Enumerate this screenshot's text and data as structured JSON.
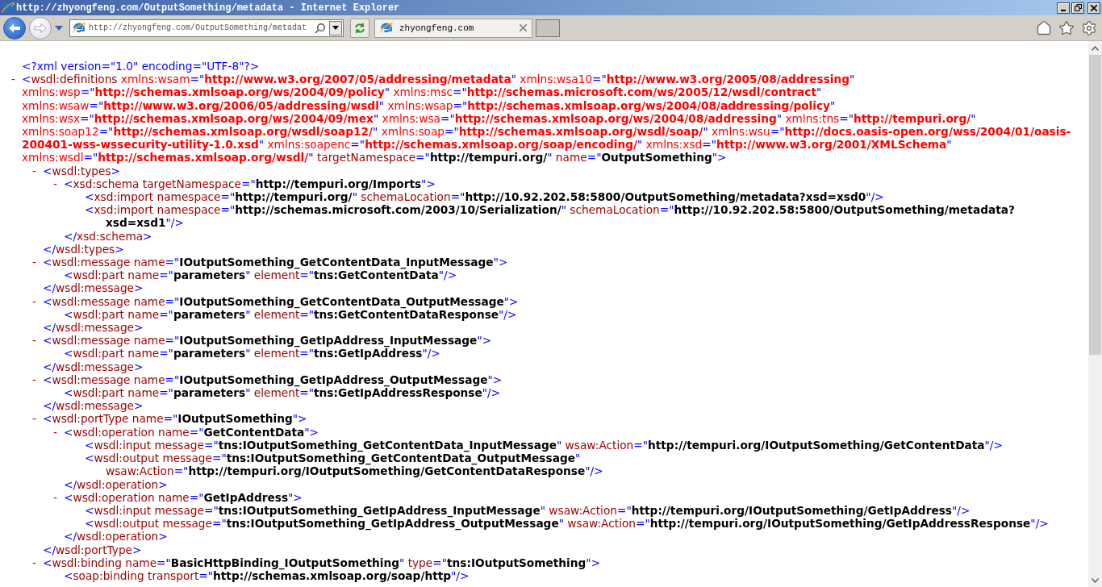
{
  "window": {
    "title": "http://zhyongfeng.com/OutputSomething/metadata - Internet Explorer"
  },
  "address_bar": {
    "value": "http://zhyongfeng.com/OutputSomething/metadat"
  },
  "tabs": [
    {
      "label": "zhyongfeng.com",
      "selected": true
    }
  ],
  "document": {
    "prolog": [
      {
        "kind": "pi",
        "text": "<?xml version=\"1.0\" encoding=\"UTF-8\"?>"
      }
    ],
    "root": {
      "toggle": "-",
      "open": [
        {
          "kind": "punct",
          "text": "<"
        },
        {
          "kind": "tag",
          "text": "wsdl:definitions"
        },
        {
          "kind": "ns_attr",
          "text": " xmlns:wsam"
        },
        {
          "kind": "punct",
          "text": "=\""
        },
        {
          "kind": "ns_value",
          "text": "http://www.w3.org/2007/05/addressing/metadata"
        },
        {
          "kind": "punct",
          "text": "\""
        },
        {
          "kind": "ns_attr",
          "text": " xmlns:wsa10"
        },
        {
          "kind": "punct",
          "text": "=\""
        },
        {
          "kind": "ns_value",
          "text": "http://www.w3.org/2005/08/addressing"
        },
        {
          "kind": "punct",
          "text": "\""
        },
        {
          "kind": "ns_attr",
          "text": " xmlns:wsp"
        },
        {
          "kind": "punct",
          "text": "=\""
        },
        {
          "kind": "ns_value",
          "text": "http://schemas.xmlsoap.org/ws/2004/09/policy"
        },
        {
          "kind": "punct",
          "text": "\""
        },
        {
          "kind": "ns_attr",
          "text": " xmlns:msc"
        },
        {
          "kind": "punct",
          "text": "=\""
        },
        {
          "kind": "ns_value",
          "text": "http://schemas.microsoft.com/ws/2005/12/wsdl/contract"
        },
        {
          "kind": "punct",
          "text": "\""
        },
        {
          "kind": "ns_attr",
          "text": " xmlns:wsaw"
        },
        {
          "kind": "punct",
          "text": "=\""
        },
        {
          "kind": "ns_value",
          "text": "http://www.w3.org/2006/05/addressing/wsdl"
        },
        {
          "kind": "punct",
          "text": "\""
        },
        {
          "kind": "ns_attr",
          "text": " xmlns:wsap"
        },
        {
          "kind": "punct",
          "text": "=\""
        },
        {
          "kind": "ns_value",
          "text": "http://schemas.xmlsoap.org/ws/2004/08/addressing/policy"
        },
        {
          "kind": "punct",
          "text": "\""
        },
        {
          "kind": "ns_attr",
          "text": " xmlns:wsx"
        },
        {
          "kind": "punct",
          "text": "=\""
        },
        {
          "kind": "ns_value",
          "text": "http://schemas.xmlsoap.org/ws/2004/09/mex"
        },
        {
          "kind": "punct",
          "text": "\""
        },
        {
          "kind": "ns_attr",
          "text": " xmlns:wsa"
        },
        {
          "kind": "punct",
          "text": "=\""
        },
        {
          "kind": "ns_value",
          "text": "http://schemas.xmlsoap.org/ws/2004/08/addressing"
        },
        {
          "kind": "punct",
          "text": "\""
        },
        {
          "kind": "ns_attr",
          "text": " xmlns:tns"
        },
        {
          "kind": "punct",
          "text": "=\""
        },
        {
          "kind": "ns_value",
          "text": "http://tempuri.org/"
        },
        {
          "kind": "punct",
          "text": "\""
        },
        {
          "kind": "ns_attr",
          "text": " xmlns:soap12"
        },
        {
          "kind": "punct",
          "text": "=\""
        },
        {
          "kind": "ns_value",
          "text": "http://schemas.xmlsoap.org/wsdl/soap12/"
        },
        {
          "kind": "punct",
          "text": "\""
        },
        {
          "kind": "ns_attr",
          "text": " xmlns:soap"
        },
        {
          "kind": "punct",
          "text": "=\""
        },
        {
          "kind": "ns_value",
          "text": "http://schemas.xmlsoap.org/wsdl/soap/"
        },
        {
          "kind": "punct",
          "text": "\""
        },
        {
          "kind": "ns_attr",
          "text": " xmlns:wsu"
        },
        {
          "kind": "punct",
          "text": "=\""
        },
        {
          "kind": "ns_value",
          "text": "http://docs.oasis-open.org/wss/2004/01/oasis-200401-wss-wssecurity-utility-1.0.xsd"
        },
        {
          "kind": "punct",
          "text": "\""
        },
        {
          "kind": "ns_attr",
          "text": " xmlns:soapenc"
        },
        {
          "kind": "punct",
          "text": "=\""
        },
        {
          "kind": "ns_value",
          "text": "http://schemas.xmlsoap.org/soap/encoding/"
        },
        {
          "kind": "punct",
          "text": "\""
        },
        {
          "kind": "ns_attr",
          "text": " xmlns:xsd"
        },
        {
          "kind": "punct",
          "text": "=\""
        },
        {
          "kind": "ns_value",
          "text": "http://www.w3.org/2001/XMLSchema"
        },
        {
          "kind": "punct",
          "text": "\""
        },
        {
          "kind": "ns_attr",
          "text": " xmlns:wsdl"
        },
        {
          "kind": "punct",
          "text": "=\""
        },
        {
          "kind": "ns_value",
          "text": "http://schemas.xmlsoap.org/wsdl/"
        },
        {
          "kind": "punct",
          "text": "\""
        },
        {
          "kind": "attr",
          "text": " targetNamespace"
        },
        {
          "kind": "punct",
          "text": "=\""
        },
        {
          "kind": "value",
          "text": "http://tempuri.org/"
        },
        {
          "kind": "punct",
          "text": "\""
        },
        {
          "kind": "attr",
          "text": " name"
        },
        {
          "kind": "punct",
          "text": "=\""
        },
        {
          "kind": "value",
          "text": "OutputSomething"
        },
        {
          "kind": "punct",
          "text": "\">"
        }
      ],
      "children": [
        {
          "toggle": "-",
          "open": [
            {
              "kind": "punct",
              "text": "<"
            },
            {
              "kind": "tag",
              "text": "wsdl:types"
            },
            {
              "kind": "punct",
              "text": ">"
            }
          ],
          "children": [
            {
              "toggle": "-",
              "open": [
                {
                  "kind": "punct",
                  "text": "<"
                },
                {
                  "kind": "tag",
                  "text": "xsd:schema"
                },
                {
                  "kind": "attr",
                  "text": " targetNamespace"
                },
                {
                  "kind": "punct",
                  "text": "=\""
                },
                {
                  "kind": "value",
                  "text": "http://tempuri.org/Imports"
                },
                {
                  "kind": "punct",
                  "text": "\">"
                }
              ],
              "children": [
                {
                  "open": [
                    {
                      "kind": "punct",
                      "text": "<"
                    },
                    {
                      "kind": "tag",
                      "text": "xsd:import"
                    },
                    {
                      "kind": "attr",
                      "text": " namespace"
                    },
                    {
                      "kind": "punct",
                      "text": "=\""
                    },
                    {
                      "kind": "value",
                      "text": "http://tempuri.org/"
                    },
                    {
                      "kind": "punct",
                      "text": "\""
                    },
                    {
                      "kind": "attr",
                      "text": " schemaLocation"
                    },
                    {
                      "kind": "punct",
                      "text": "=\""
                    },
                    {
                      "kind": "value",
                      "text": "http://10.92.202.58:5800/OutputSomething/metadata?xsd=xsd0"
                    },
                    {
                      "kind": "punct",
                      "text": "\"/>"
                    }
                  ]
                },
                {
                  "open": [
                    {
                      "kind": "punct",
                      "text": "<"
                    },
                    {
                      "kind": "tag",
                      "text": "xsd:import"
                    },
                    {
                      "kind": "attr",
                      "text": " namespace"
                    },
                    {
                      "kind": "punct",
                      "text": "=\""
                    },
                    {
                      "kind": "value",
                      "text": "http://schemas.microsoft.com/2003/10/Serialization/"
                    },
                    {
                      "kind": "punct",
                      "text": "\""
                    },
                    {
                      "kind": "attr",
                      "text": " schemaLocation"
                    },
                    {
                      "kind": "punct",
                      "text": "=\""
                    },
                    {
                      "kind": "value",
                      "text": "http://10.92.202.58:5800/OutputSomething/metadata?xsd=xsd1"
                    },
                    {
                      "kind": "punct",
                      "text": "\"/>"
                    }
                  ]
                }
              ],
              "close": [
                {
                  "kind": "punct",
                  "text": "</"
                },
                {
                  "kind": "tag",
                  "text": "xsd:schema"
                },
                {
                  "kind": "punct",
                  "text": ">"
                }
              ]
            }
          ],
          "close": [
            {
              "kind": "punct",
              "text": "</"
            },
            {
              "kind": "tag",
              "text": "wsdl:types"
            },
            {
              "kind": "punct",
              "text": ">"
            }
          ]
        },
        {
          "toggle": "-",
          "open": [
            {
              "kind": "punct",
              "text": "<"
            },
            {
              "kind": "tag",
              "text": "wsdl:message"
            },
            {
              "kind": "attr",
              "text": " name"
            },
            {
              "kind": "punct",
              "text": "=\""
            },
            {
              "kind": "value",
              "text": "IOutputSomething_GetContentData_InputMessage"
            },
            {
              "kind": "punct",
              "text": "\">"
            }
          ],
          "children": [
            {
              "open": [
                {
                  "kind": "punct",
                  "text": "<"
                },
                {
                  "kind": "tag",
                  "text": "wsdl:part"
                },
                {
                  "kind": "attr",
                  "text": " name"
                },
                {
                  "kind": "punct",
                  "text": "=\""
                },
                {
                  "kind": "value",
                  "text": "parameters"
                },
                {
                  "kind": "punct",
                  "text": "\""
                },
                {
                  "kind": "attr",
                  "text": " element"
                },
                {
                  "kind": "punct",
                  "text": "=\""
                },
                {
                  "kind": "value",
                  "text": "tns:GetContentData"
                },
                {
                  "kind": "punct",
                  "text": "\"/>"
                }
              ]
            }
          ],
          "close": [
            {
              "kind": "punct",
              "text": "</"
            },
            {
              "kind": "tag",
              "text": "wsdl:message"
            },
            {
              "kind": "punct",
              "text": ">"
            }
          ]
        },
        {
          "toggle": "-",
          "open": [
            {
              "kind": "punct",
              "text": "<"
            },
            {
              "kind": "tag",
              "text": "wsdl:message"
            },
            {
              "kind": "attr",
              "text": " name"
            },
            {
              "kind": "punct",
              "text": "=\""
            },
            {
              "kind": "value",
              "text": "IOutputSomething_GetContentData_OutputMessage"
            },
            {
              "kind": "punct",
              "text": "\">"
            }
          ],
          "children": [
            {
              "open": [
                {
                  "kind": "punct",
                  "text": "<"
                },
                {
                  "kind": "tag",
                  "text": "wsdl:part"
                },
                {
                  "kind": "attr",
                  "text": " name"
                },
                {
                  "kind": "punct",
                  "text": "=\""
                },
                {
                  "kind": "value",
                  "text": "parameters"
                },
                {
                  "kind": "punct",
                  "text": "\""
                },
                {
                  "kind": "attr",
                  "text": " element"
                },
                {
                  "kind": "punct",
                  "text": "=\""
                },
                {
                  "kind": "value",
                  "text": "tns:GetContentDataResponse"
                },
                {
                  "kind": "punct",
                  "text": "\"/>"
                }
              ]
            }
          ],
          "close": [
            {
              "kind": "punct",
              "text": "</"
            },
            {
              "kind": "tag",
              "text": "wsdl:message"
            },
            {
              "kind": "punct",
              "text": ">"
            }
          ]
        },
        {
          "toggle": "-",
          "open": [
            {
              "kind": "punct",
              "text": "<"
            },
            {
              "kind": "tag",
              "text": "wsdl:message"
            },
            {
              "kind": "attr",
              "text": " name"
            },
            {
              "kind": "punct",
              "text": "=\""
            },
            {
              "kind": "value",
              "text": "IOutputSomething_GetIpAddress_InputMessage"
            },
            {
              "kind": "punct",
              "text": "\">"
            }
          ],
          "children": [
            {
              "open": [
                {
                  "kind": "punct",
                  "text": "<"
                },
                {
                  "kind": "tag",
                  "text": "wsdl:part"
                },
                {
                  "kind": "attr",
                  "text": " name"
                },
                {
                  "kind": "punct",
                  "text": "=\""
                },
                {
                  "kind": "value",
                  "text": "parameters"
                },
                {
                  "kind": "punct",
                  "text": "\""
                },
                {
                  "kind": "attr",
                  "text": " element"
                },
                {
                  "kind": "punct",
                  "text": "=\""
                },
                {
                  "kind": "value",
                  "text": "tns:GetIpAddress"
                },
                {
                  "kind": "punct",
                  "text": "\"/>"
                }
              ]
            }
          ],
          "close": [
            {
              "kind": "punct",
              "text": "</"
            },
            {
              "kind": "tag",
              "text": "wsdl:message"
            },
            {
              "kind": "punct",
              "text": ">"
            }
          ]
        },
        {
          "toggle": "-",
          "open": [
            {
              "kind": "punct",
              "text": "<"
            },
            {
              "kind": "tag",
              "text": "wsdl:message"
            },
            {
              "kind": "attr",
              "text": " name"
            },
            {
              "kind": "punct",
              "text": "=\""
            },
            {
              "kind": "value",
              "text": "IOutputSomething_GetIpAddress_OutputMessage"
            },
            {
              "kind": "punct",
              "text": "\">"
            }
          ],
          "children": [
            {
              "open": [
                {
                  "kind": "punct",
                  "text": "<"
                },
                {
                  "kind": "tag",
                  "text": "wsdl:part"
                },
                {
                  "kind": "attr",
                  "text": " name"
                },
                {
                  "kind": "punct",
                  "text": "=\""
                },
                {
                  "kind": "value",
                  "text": "parameters"
                },
                {
                  "kind": "punct",
                  "text": "\""
                },
                {
                  "kind": "attr",
                  "text": " element"
                },
                {
                  "kind": "punct",
                  "text": "=\""
                },
                {
                  "kind": "value",
                  "text": "tns:GetIpAddressResponse"
                },
                {
                  "kind": "punct",
                  "text": "\"/>"
                }
              ]
            }
          ],
          "close": [
            {
              "kind": "punct",
              "text": "</"
            },
            {
              "kind": "tag",
              "text": "wsdl:message"
            },
            {
              "kind": "punct",
              "text": ">"
            }
          ]
        },
        {
          "toggle": "-",
          "open": [
            {
              "kind": "punct",
              "text": "<"
            },
            {
              "kind": "tag",
              "text": "wsdl:portType"
            },
            {
              "kind": "attr",
              "text": " name"
            },
            {
              "kind": "punct",
              "text": "=\""
            },
            {
              "kind": "value",
              "text": "IOutputSomething"
            },
            {
              "kind": "punct",
              "text": "\">"
            }
          ],
          "children": [
            {
              "toggle": "-",
              "open": [
                {
                  "kind": "punct",
                  "text": "<"
                },
                {
                  "kind": "tag",
                  "text": "wsdl:operation"
                },
                {
                  "kind": "attr",
                  "text": " name"
                },
                {
                  "kind": "punct",
                  "text": "=\""
                },
                {
                  "kind": "value",
                  "text": "GetContentData"
                },
                {
                  "kind": "punct",
                  "text": "\">"
                }
              ],
              "children": [
                {
                  "open": [
                    {
                      "kind": "punct",
                      "text": "<"
                    },
                    {
                      "kind": "tag",
                      "text": "wsdl:input"
                    },
                    {
                      "kind": "attr",
                      "text": " message"
                    },
                    {
                      "kind": "punct",
                      "text": "=\""
                    },
                    {
                      "kind": "value",
                      "text": "tns:IOutputSomething_GetContentData_InputMessage"
                    },
                    {
                      "kind": "punct",
                      "text": "\""
                    },
                    {
                      "kind": "attr",
                      "text": " wsaw:Action"
                    },
                    {
                      "kind": "punct",
                      "text": "=\""
                    },
                    {
                      "kind": "value",
                      "text": "http://tempuri.org/IOutputSomething/GetContentData"
                    },
                    {
                      "kind": "punct",
                      "text": "\"/>"
                    }
                  ]
                },
                {
                  "open": [
                    {
                      "kind": "punct",
                      "text": "<"
                    },
                    {
                      "kind": "tag",
                      "text": "wsdl:output"
                    },
                    {
                      "kind": "attr",
                      "text": " message"
                    },
                    {
                      "kind": "punct",
                      "text": "=\""
                    },
                    {
                      "kind": "value",
                      "text": "tns:IOutputSomething_GetContentData_OutputMessage"
                    },
                    {
                      "kind": "punct",
                      "text": "\""
                    },
                    {
                      "kind": "attr",
                      "text": " wsaw:Action"
                    },
                    {
                      "kind": "punct",
                      "text": "=\""
                    },
                    {
                      "kind": "value",
                      "text": "http://tempuri.org/IOutputSomething/GetContentDataResponse"
                    },
                    {
                      "kind": "punct",
                      "text": "\"/>"
                    }
                  ]
                }
              ],
              "close": [
                {
                  "kind": "punct",
                  "text": "</"
                },
                {
                  "kind": "tag",
                  "text": "wsdl:operation"
                },
                {
                  "kind": "punct",
                  "text": ">"
                }
              ]
            },
            {
              "toggle": "-",
              "open": [
                {
                  "kind": "punct",
                  "text": "<"
                },
                {
                  "kind": "tag",
                  "text": "wsdl:operation"
                },
                {
                  "kind": "attr",
                  "text": " name"
                },
                {
                  "kind": "punct",
                  "text": "=\""
                },
                {
                  "kind": "value",
                  "text": "GetIpAddress"
                },
                {
                  "kind": "punct",
                  "text": "\">"
                }
              ],
              "children": [
                {
                  "open": [
                    {
                      "kind": "punct",
                      "text": "<"
                    },
                    {
                      "kind": "tag",
                      "text": "wsdl:input"
                    },
                    {
                      "kind": "attr",
                      "text": " message"
                    },
                    {
                      "kind": "punct",
                      "text": "=\""
                    },
                    {
                      "kind": "value",
                      "text": "tns:IOutputSomething_GetIpAddress_InputMessage"
                    },
                    {
                      "kind": "punct",
                      "text": "\""
                    },
                    {
                      "kind": "attr",
                      "text": " wsaw:Action"
                    },
                    {
                      "kind": "punct",
                      "text": "=\""
                    },
                    {
                      "kind": "value",
                      "text": "http://tempuri.org/IOutputSomething/GetIpAddress"
                    },
                    {
                      "kind": "punct",
                      "text": "\"/>"
                    }
                  ]
                },
                {
                  "open": [
                    {
                      "kind": "punct",
                      "text": "<"
                    },
                    {
                      "kind": "tag",
                      "text": "wsdl:output"
                    },
                    {
                      "kind": "attr",
                      "text": " message"
                    },
                    {
                      "kind": "punct",
                      "text": "=\""
                    },
                    {
                      "kind": "value",
                      "text": "tns:IOutputSomething_GetIpAddress_OutputMessage"
                    },
                    {
                      "kind": "punct",
                      "text": "\""
                    },
                    {
                      "kind": "attr",
                      "text": " wsaw:Action"
                    },
                    {
                      "kind": "punct",
                      "text": "=\""
                    },
                    {
                      "kind": "value",
                      "text": "http://tempuri.org/IOutputSomething/GetIpAddressResponse"
                    },
                    {
                      "kind": "punct",
                      "text": "\"/>"
                    }
                  ]
                }
              ],
              "close": [
                {
                  "kind": "punct",
                  "text": "</"
                },
                {
                  "kind": "tag",
                  "text": "wsdl:operation"
                },
                {
                  "kind": "punct",
                  "text": ">"
                }
              ]
            }
          ],
          "close": [
            {
              "kind": "punct",
              "text": "</"
            },
            {
              "kind": "tag",
              "text": "wsdl:portType"
            },
            {
              "kind": "punct",
              "text": ">"
            }
          ]
        },
        {
          "toggle": "-",
          "open": [
            {
              "kind": "punct",
              "text": "<"
            },
            {
              "kind": "tag",
              "text": "wsdl:binding"
            },
            {
              "kind": "attr",
              "text": " name"
            },
            {
              "kind": "punct",
              "text": "=\""
            },
            {
              "kind": "value",
              "text": "BasicHttpBinding_IOutputSomething"
            },
            {
              "kind": "punct",
              "text": "\""
            },
            {
              "kind": "attr",
              "text": " type"
            },
            {
              "kind": "punct",
              "text": "=\""
            },
            {
              "kind": "value",
              "text": "tns:IOutputSomething"
            },
            {
              "kind": "punct",
              "text": "\">"
            }
          ],
          "children": [
            {
              "open": [
                {
                  "kind": "punct",
                  "text": "<"
                },
                {
                  "kind": "tag",
                  "text": "soap:binding"
                },
                {
                  "kind": "attr",
                  "text": " transport"
                },
                {
                  "kind": "punct",
                  "text": "=\""
                },
                {
                  "kind": "value",
                  "text": "http://schemas.xmlsoap.org/soap/http"
                },
                {
                  "kind": "punct",
                  "text": "\"/>"
                }
              ]
            }
          ]
        }
      ]
    }
  }
}
